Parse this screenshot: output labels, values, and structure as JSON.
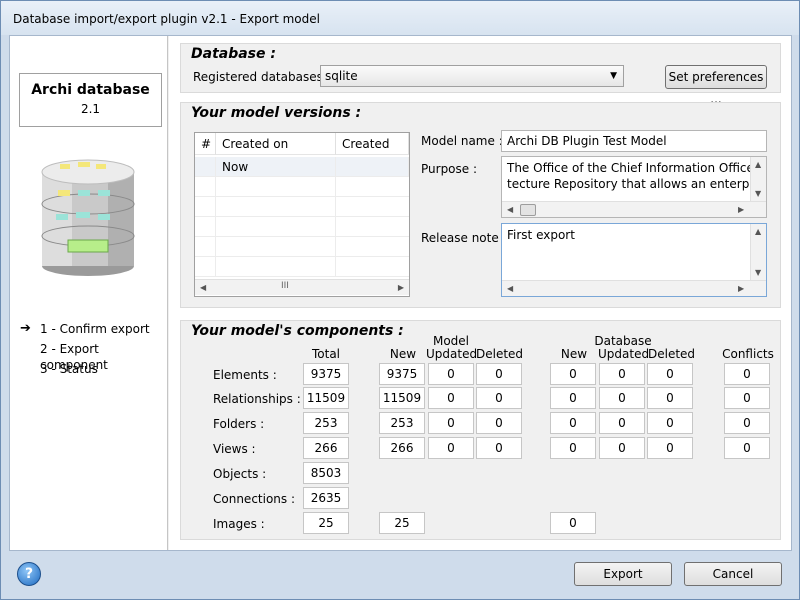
{
  "window": {
    "title": "Database import/export plugin v2.1 - Export model"
  },
  "left": {
    "app_name": "Archi database",
    "version": "2.1",
    "steps": [
      {
        "label": "1 - Confirm export",
        "current": true
      },
      {
        "label": "2 - Export component",
        "current": false
      },
      {
        "label": "3 - Status",
        "current": false
      }
    ],
    "arrow_glyph": "➔"
  },
  "database": {
    "group_title": "Database :",
    "registered_label": "Registered databases :",
    "selected": "sqlite",
    "set_prefs": "Set preferences ..."
  },
  "versions": {
    "group_title": "Your model versions :",
    "columns": [
      "#",
      "Created on",
      "Created by"
    ],
    "rows": [
      {
        "num": "",
        "created_on": "Now",
        "created_by": ""
      }
    ],
    "model_name_label": "Model name :",
    "model_name": "Archi DB Plugin Test Model",
    "purpose_label": "Purpose :",
    "purpose_text": "The Office of the Chief Information Officer (C\ntecture Repository that allows an enterprise tc",
    "release_label": "Release note :",
    "release_text": "First export",
    "hscroll_glyph": "III"
  },
  "components": {
    "group_title": "Your model's components :",
    "headers": {
      "total": "Total",
      "model": "Model",
      "database": "Database",
      "new": "New",
      "updated": "Updated",
      "deleted": "Deleted",
      "conflicts": "Conflicts"
    },
    "rows": [
      {
        "label": "Elements :",
        "total": "9375",
        "m_new": "9375",
        "m_upd": "0",
        "m_del": "0",
        "d_new": "0",
        "d_upd": "0",
        "d_del": "0",
        "conf": "0"
      },
      {
        "label": "Relationships :",
        "total": "11509",
        "m_new": "11509",
        "m_upd": "0",
        "m_del": "0",
        "d_new": "0",
        "d_upd": "0",
        "d_del": "0",
        "conf": "0"
      },
      {
        "label": "Folders :",
        "total": "253",
        "m_new": "253",
        "m_upd": "0",
        "m_del": "0",
        "d_new": "0",
        "d_upd": "0",
        "d_del": "0",
        "conf": "0"
      },
      {
        "label": "Views :",
        "total": "266",
        "m_new": "266",
        "m_upd": "0",
        "m_del": "0",
        "d_new": "0",
        "d_upd": "0",
        "d_del": "0",
        "conf": "0"
      },
      {
        "label": "Objects :",
        "total": "8503"
      },
      {
        "label": "Connections :",
        "total": "2635"
      },
      {
        "label": "Images :",
        "total": "25",
        "m_new": "25",
        "d_new": "0"
      }
    ]
  },
  "footer": {
    "export": "Export",
    "cancel": "Cancel",
    "help_glyph": "?"
  }
}
